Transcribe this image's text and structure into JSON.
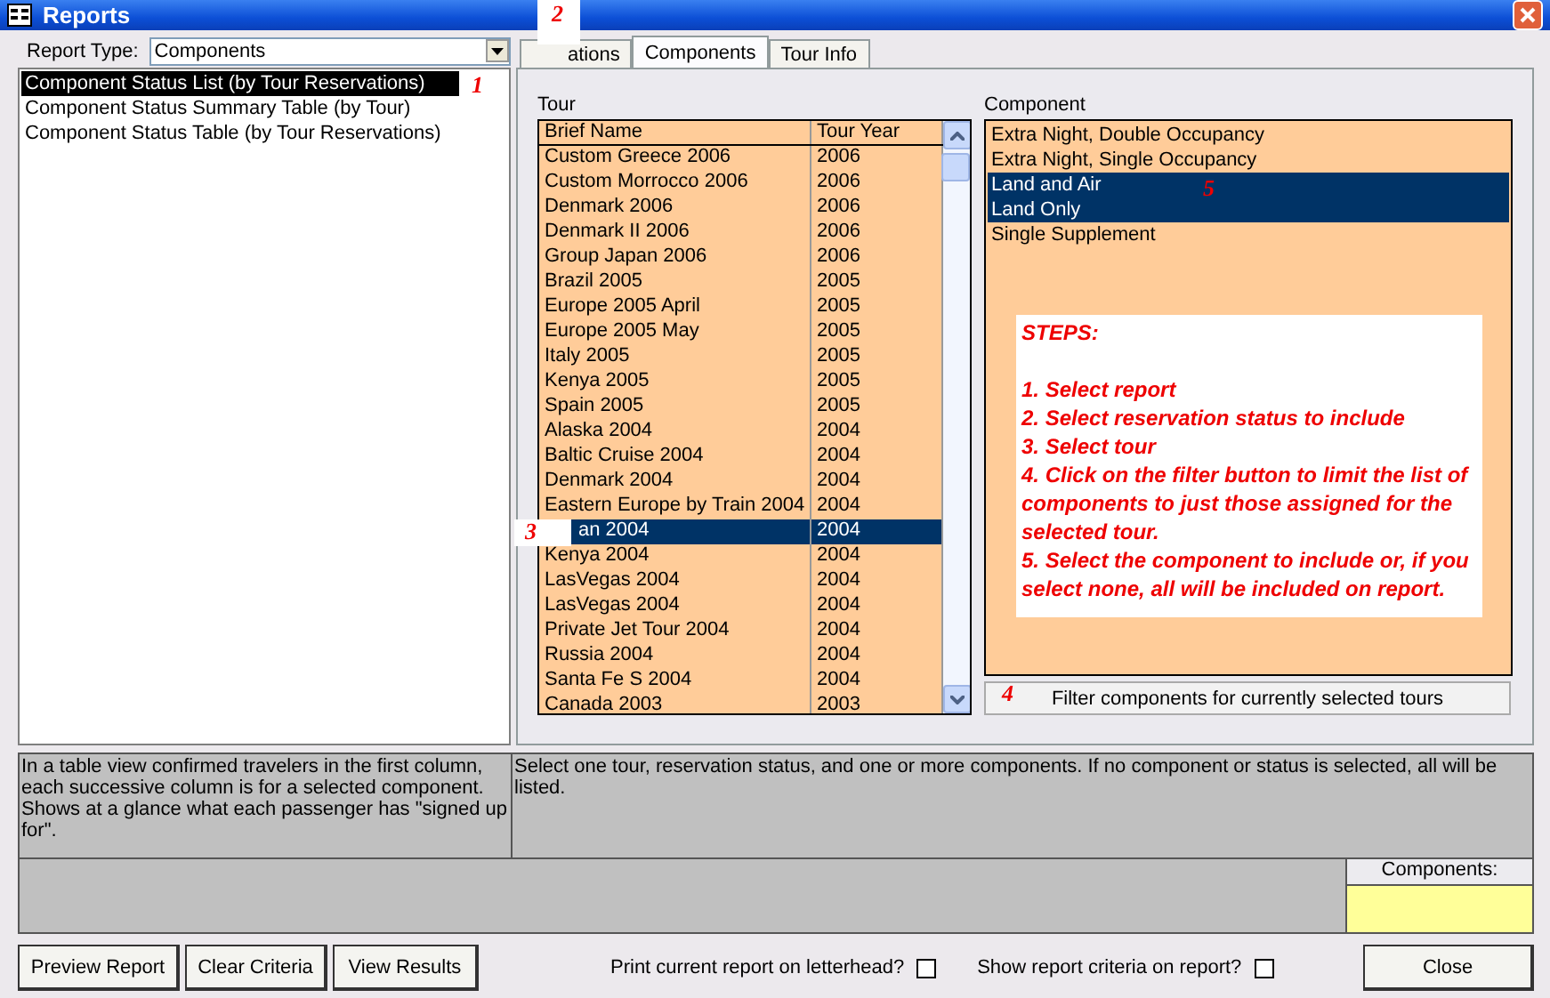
{
  "window": {
    "title": "Reports"
  },
  "report_type": {
    "label": "Report Type:",
    "value": "Components"
  },
  "reports": [
    {
      "label": "Component Status List (by Tour Reservations)",
      "selected": true
    },
    {
      "label": "Component Status Summary Table (by Tour)",
      "selected": false
    },
    {
      "label": "Component Status Table (by Tour Reservations)",
      "selected": false
    }
  ],
  "tabs": [
    {
      "label": "ations",
      "selected": false
    },
    {
      "label": "Components",
      "selected": true
    },
    {
      "label": "Tour Info",
      "selected": false
    }
  ],
  "tour": {
    "label": "Tour",
    "columns": [
      "Brief Name",
      "Tour Year"
    ],
    "rows": [
      {
        "name": "Custom Greece 2006",
        "year": "2006",
        "selected": false
      },
      {
        "name": "Custom Morrocco 2006",
        "year": "2006",
        "selected": false
      },
      {
        "name": "Denmark 2006",
        "year": "2006",
        "selected": false
      },
      {
        "name": "Denmark II 2006",
        "year": "2006",
        "selected": false
      },
      {
        "name": "Group Japan 2006",
        "year": "2006",
        "selected": false
      },
      {
        "name": "Brazil 2005",
        "year": "2005",
        "selected": false
      },
      {
        "name": "Europe 2005 April",
        "year": "2005",
        "selected": false
      },
      {
        "name": "Europe 2005 May",
        "year": "2005",
        "selected": false
      },
      {
        "name": "Italy 2005",
        "year": "2005",
        "selected": false
      },
      {
        "name": "Kenya 2005",
        "year": "2005",
        "selected": false
      },
      {
        "name": "Spain 2005",
        "year": "2005",
        "selected": false
      },
      {
        "name": "Alaska 2004",
        "year": "2004",
        "selected": false
      },
      {
        "name": "Baltic Cruise 2004",
        "year": "2004",
        "selected": false
      },
      {
        "name": "Denmark 2004",
        "year": "2004",
        "selected": false
      },
      {
        "name": "Eastern Europe by Train  2004",
        "year": "2004",
        "selected": false
      },
      {
        "name": "an 2004",
        "year": "2004",
        "selected": true
      },
      {
        "name": "Kenya 2004",
        "year": "2004",
        "selected": false
      },
      {
        "name": "LasVegas 2004",
        "year": "2004",
        "selected": false
      },
      {
        "name": "LasVegas 2004",
        "year": "2004",
        "selected": false
      },
      {
        "name": "Private Jet Tour 2004",
        "year": "2004",
        "selected": false
      },
      {
        "name": "Russia  2004",
        "year": "2004",
        "selected": false
      },
      {
        "name": "Santa Fe S 2004",
        "year": "2004",
        "selected": false
      },
      {
        "name": "Canada 2003",
        "year": "2003",
        "selected": false
      }
    ]
  },
  "component": {
    "label": "Component",
    "items": [
      {
        "label": "Extra Night, Double Occupancy",
        "selected": false
      },
      {
        "label": "Extra Night, Single Occupancy",
        "selected": false
      },
      {
        "label": "Land and Air",
        "selected": true
      },
      {
        "label": "Land Only",
        "selected": true
      },
      {
        "label": "Single Supplement",
        "selected": false
      }
    ]
  },
  "steps": [
    "STEPS:",
    "1. Select report",
    "2. Select reservation status to include",
    "3. Select tour",
    "4. Click on the filter button to limit the list of components to just those assigned for the selected tour.",
    "5. Select the component to include or, if you select none, all will be included on report."
  ],
  "filter_button": "Filter components for currently selected tours",
  "annotations": [
    "1",
    "2",
    "3",
    "4",
    "5"
  ],
  "report_description": "In a table view confirmed travelers in the first column, each successive column is for a selected component. Shows at a glance what each passenger has \"signed up for\".",
  "criteria_description": "Select one tour, reservation status,  and one or more components. If no component or status is selected, all will be listed.",
  "components_label": "Components:",
  "buttons": [
    "Preview Report",
    "Clear Criteria",
    "View Results"
  ],
  "options": [
    {
      "label": "Print current report on letterhead?",
      "checked": false
    },
    {
      "label": "Show report criteria on report?",
      "checked": false
    }
  ],
  "close_button": "Close"
}
